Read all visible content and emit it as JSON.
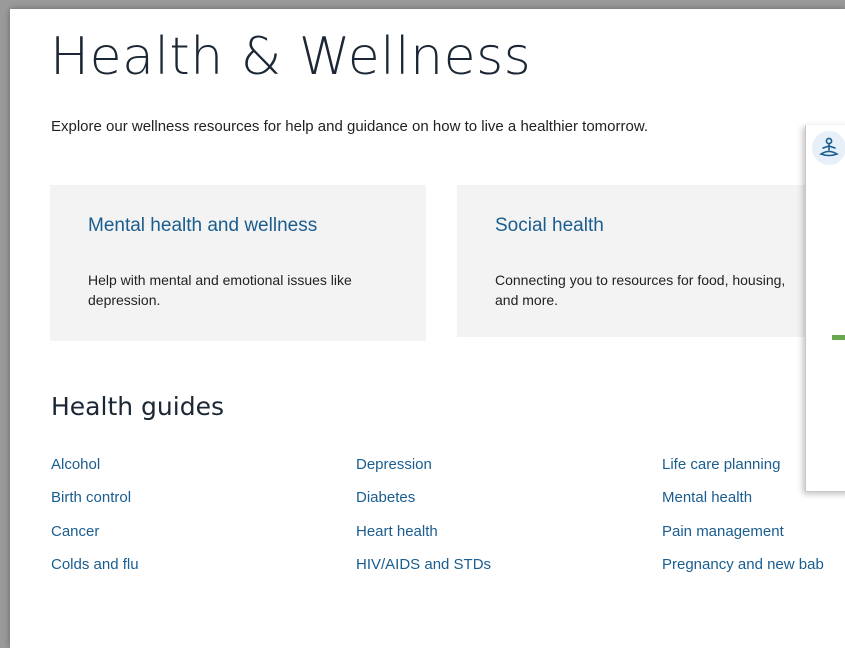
{
  "page": {
    "title": "Health & Wellness",
    "intro": "Explore our wellness resources for help and guidance on how to live a healthier tomorrow."
  },
  "cards": [
    {
      "title": "Mental health and wellness",
      "desc": "Help with mental and emotional issues like depression."
    },
    {
      "title": "Social health",
      "desc": "Connecting you to resources for food, housing, and more."
    }
  ],
  "guides": {
    "heading": "Health guides",
    "col1": [
      "Alcohol",
      "Birth control",
      "Cancer",
      "Colds and flu"
    ],
    "col2": [
      "Depression",
      "Diabetes",
      "Heart health",
      "HIV/AIDS and STDs"
    ],
    "col3": [
      "Life care planning",
      "Mental health",
      "Pain management",
      "Pregnancy and new bab"
    ]
  },
  "popup": {
    "icon": "meditation-icon",
    "accent_color": "#6aa84f"
  },
  "colors": {
    "link": "#1a5d8f",
    "heading": "#1b2735",
    "card_bg": "#f3f3f3"
  }
}
